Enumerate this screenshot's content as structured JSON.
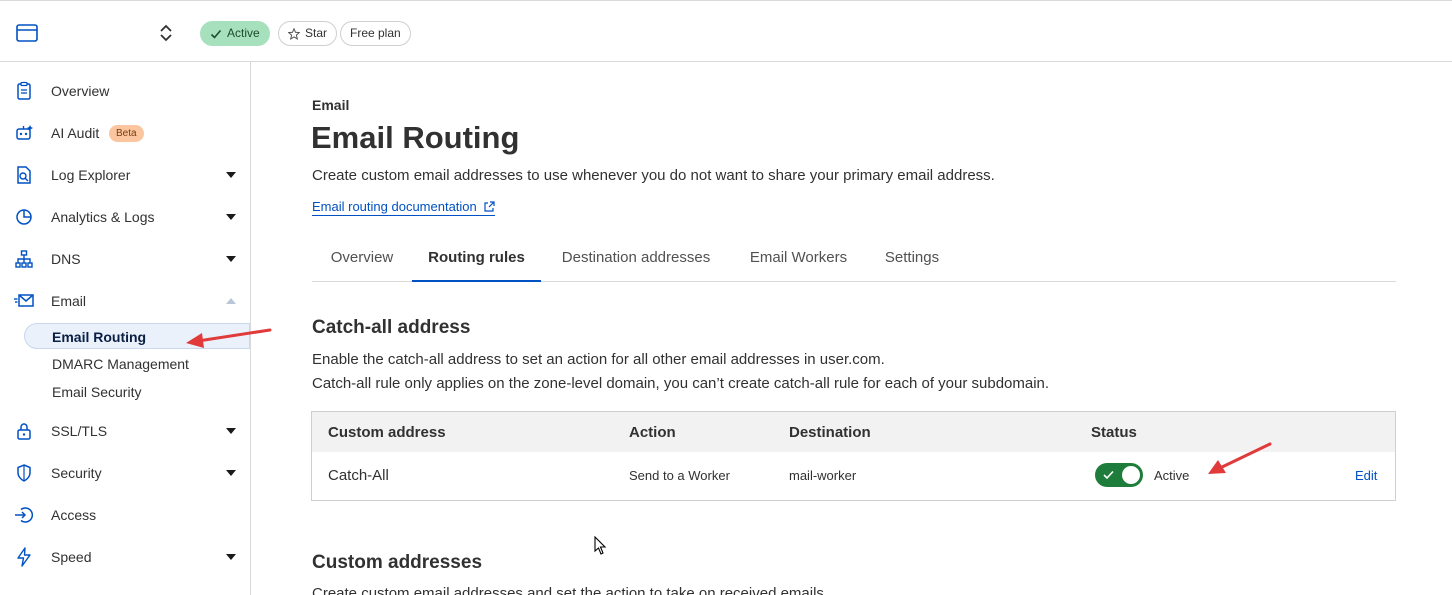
{
  "topbar": {
    "badges": {
      "active": "Active",
      "star": "Star",
      "plan": "Free plan"
    }
  },
  "sidebar": {
    "items": [
      {
        "label": "Overview",
        "icon": "clipboard-icon"
      },
      {
        "label": "AI Audit",
        "icon": "robot-icon",
        "badge": "Beta"
      },
      {
        "label": "Log Explorer",
        "icon": "document-search-icon"
      },
      {
        "label": "Analytics & Logs",
        "icon": "pie-chart-icon"
      },
      {
        "label": "DNS",
        "icon": "network-icon"
      },
      {
        "label": "Email",
        "icon": "envelope-icon"
      },
      {
        "label": "SSL/TLS",
        "icon": "lock-icon"
      },
      {
        "label": "Security",
        "icon": "shield-icon"
      },
      {
        "label": "Access",
        "icon": "login-icon"
      },
      {
        "label": "Speed",
        "icon": "lightning-icon"
      }
    ],
    "email_sub": [
      "Email Routing",
      "DMARC Management",
      "Email Security"
    ]
  },
  "main": {
    "eyebrow": "Email",
    "title": "Email Routing",
    "subtitle": "Create custom email addresses to use whenever you do not want to share your primary email address.",
    "doc_link": "Email routing documentation",
    "tabs": [
      "Overview",
      "Routing rules",
      "Destination addresses",
      "Email Workers",
      "Settings"
    ],
    "catchall": {
      "title": "Catch-all address",
      "desc1": "Enable the catch-all address to set an action for all other email addresses in user.com.",
      "desc2": "Catch-all rule only applies on the zone-level domain, you can’t create catch-all rule for each of your subdomain.",
      "headers": [
        "Custom address",
        "Action",
        "Destination",
        "Status"
      ],
      "row": {
        "address": "Catch-All",
        "action": "Send to a Worker",
        "destination": "mail-worker",
        "status": "Active",
        "edit": "Edit"
      }
    },
    "custom": {
      "title": "Custom addresses",
      "desc": "Create custom email addresses and set the action to take on received emails."
    }
  },
  "colors": {
    "accent": "#0051c3",
    "toggle_on": "#1f7d3b",
    "annotation": "#e03a3a"
  }
}
